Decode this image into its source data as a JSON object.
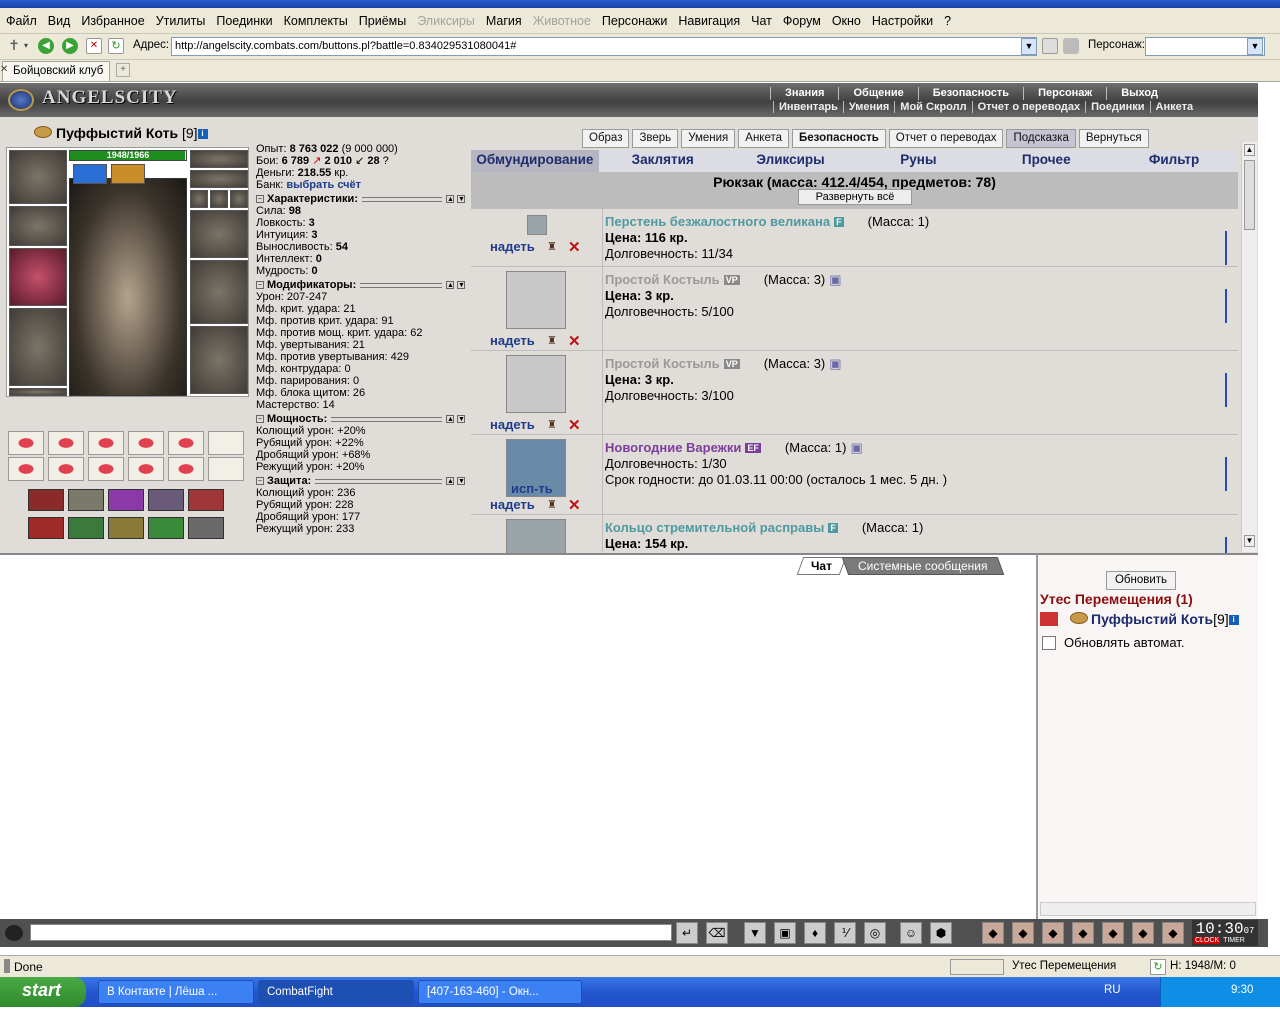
{
  "menu": [
    "Файл",
    "Вид",
    "Избранное",
    "Утилиты",
    "Поединки",
    "Комплекты",
    "Приёмы",
    "Эликсиры",
    "Магия",
    "Животное",
    "Персонажи",
    "Навигация",
    "Чат",
    "Форум",
    "Окно",
    "Настройки",
    "?"
  ],
  "menu_disabled": [
    "Эликсиры",
    "Животное"
  ],
  "address_label": "Адрес:",
  "address_url": "http://angelscity.combats.com/buttons.pl?battle=0.834029531080041#",
  "person_label": "Персонаж:",
  "tab_title": "Бойцовский клуб",
  "game": {
    "logo": "ANGELSCITY",
    "top_nav": [
      "Знания",
      "Общение",
      "Безопасность",
      "Персонаж",
      "Выход"
    ],
    "sub_nav": [
      "Инвентарь",
      "Умения",
      "Мой Скролл",
      "Отчет о переводах",
      "Поединки",
      "Анкета"
    ]
  },
  "player": {
    "name": "Пуффыстий Коть",
    "level": "[9]",
    "hp_text": "1948/1966",
    "hp_fraction": 0.99
  },
  "stats": {
    "exp_label": "Опыт:",
    "exp_value": "8 763 022",
    "exp_next": "(9 000 000)",
    "fights_label": "Бои:",
    "fights_won": "6 789",
    "fights_lost": "2 010",
    "fights_draw": "28",
    "money_label": "Деньги:",
    "money_value": "218.55",
    "money_unit": "кр.",
    "bank_label": "Банк:",
    "bank_link": "выбрать счёт",
    "char_header": "Характеристики:",
    "chars": [
      {
        "label": "Сила:",
        "value": "98"
      },
      {
        "label": "Ловкость:",
        "value": "3"
      },
      {
        "label": "Интуиция:",
        "value": "3"
      },
      {
        "label": "Выносливость:",
        "value": "54"
      },
      {
        "label": "Интеллект:",
        "value": "0"
      },
      {
        "label": "Мудрость:",
        "value": "0"
      }
    ],
    "mods_header": "Модификаторы:",
    "mods": [
      "Урон: 207-247",
      "Мф. крит. удара: 21",
      "Мф. против крит. удара: 91",
      "Мф. против мощ. крит. удара: 62",
      "Мф. увертывания: 21",
      "Мф. против увертывания: 429",
      "Мф. контрудара: 0",
      "Мф. парирования: 0",
      "Мф. блока щитом: 26",
      "Мастерство: 14"
    ],
    "power_header": "Мощность:",
    "power": [
      "Колющий урон: +20%",
      "Рубящий урон: +22%",
      "Дробящий урон: +68%",
      "Режущий урон: +20%"
    ],
    "def_header": "Защита:",
    "def": [
      "Колющий урон: 236",
      "Рубящий урон: 228",
      "Дробящий урон: 177",
      "Режущий урон: 233"
    ]
  },
  "buttons": [
    {
      "label": "Образ",
      "style": ""
    },
    {
      "label": "Зверь",
      "style": ""
    },
    {
      "label": "Умения",
      "style": ""
    },
    {
      "label": "Анкета",
      "style": ""
    },
    {
      "label": "Безопасность",
      "style": "bold"
    },
    {
      "label": "Отчет о переводах",
      "style": ""
    },
    {
      "label": "Подсказка",
      "style": "act"
    },
    {
      "label": "Вернуться",
      "style": ""
    }
  ],
  "inv_tabs": [
    "Обмундирование",
    "Заклятия",
    "Эликсиры",
    "Руны",
    "Прочее",
    "Фильтр"
  ],
  "backpack": {
    "title": "Рюкзак (масса: 412.4/454, предметов: 78)",
    "expand": "Развернуть всё"
  },
  "items": [
    {
      "name": "Перстень безжалостного великана",
      "tag": "F",
      "mass": "(Масса: 1)",
      "action": "надеть",
      "line2": "Цена: 116 кр.",
      "line3": "Долговечность: 11/34",
      "line4": ""
    },
    {
      "name": "Простой Костыль",
      "tag": "VP",
      "mass": "(Масса: 3)",
      "action": "надеть",
      "line2": "Цена: 3 кр.",
      "line3": "Долговечность: 5/100",
      "line4": ""
    },
    {
      "name": "Простой Костыль",
      "tag": "VP",
      "mass": "(Масса: 3)",
      "action": "надеть",
      "line2": "Цена: 3 кр.",
      "line3": "Долговечность: 3/100",
      "line4": ""
    },
    {
      "name": "Новогодние Варежки",
      "tag": "EF",
      "mass": "(Масса: 1)",
      "action": "исп-ть",
      "action2": "надеть",
      "line2": "Долговечность: 1/30",
      "line3": "Срок годности: до 01.03.11 00:00 (осталось 1 мес. 5 дн. )",
      "line4": ""
    },
    {
      "name": "Кольцо стремительной расправы",
      "tag": "F",
      "mass": "(Масса: 1)",
      "action": "",
      "line2": "Цена: 154 кр.",
      "line3": "",
      "line4": ""
    }
  ],
  "chat": {
    "tab_chat": "Чат",
    "tab_sys": "Системные сообщения",
    "refresh": "Обновить",
    "location": "Утес Перемещения (1)",
    "user": "Пуффыстий Коть",
    "user_level": "[9]",
    "auto": "Обновлять автомат."
  },
  "clock": {
    "time": "10:30",
    "sec": "07",
    "l1": "CLOCK",
    "l2": "TIMER"
  },
  "status": {
    "left": "Done",
    "location": "Утес Перемещения",
    "hm": "H: 1948/M: 0"
  },
  "taskbar": {
    "start": "start",
    "tasks": [
      "В Контакте | Лёша ...",
      "CombatFight",
      "[407-163-460] - Окн..."
    ],
    "lang": "RU",
    "time": "9:30"
  }
}
